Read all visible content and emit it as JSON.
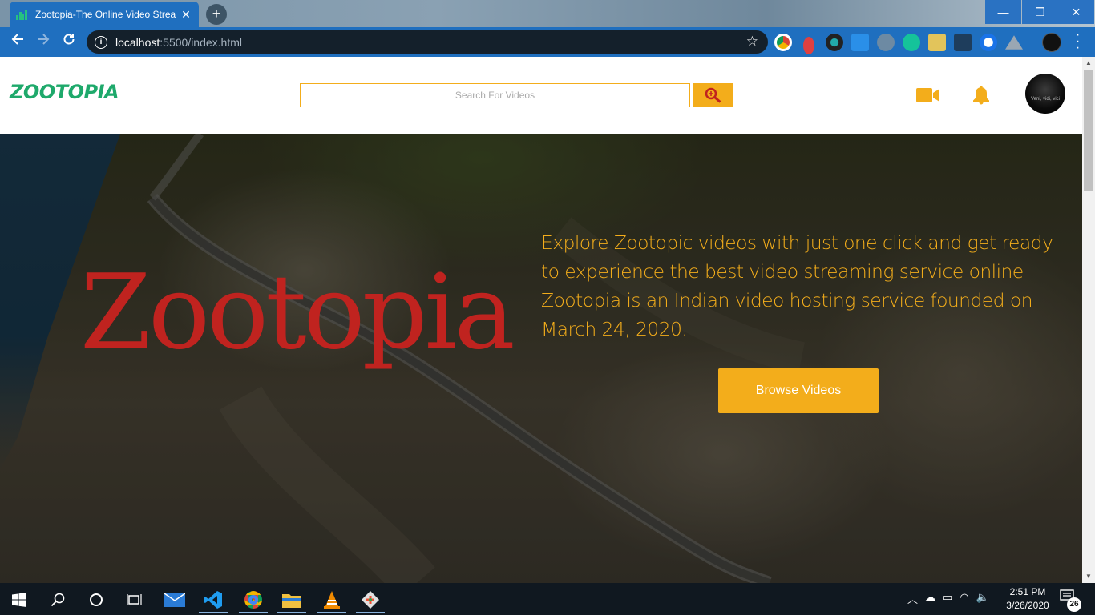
{
  "browser": {
    "tab_title": "Zootopia-The Online Video Strea",
    "tab_close": "✕",
    "new_tab": "+",
    "url_host": "localhost",
    "url_rest": ":5500/index.html",
    "window_controls": {
      "minimize": "—",
      "maximize": "❐",
      "close": "✕"
    },
    "extensions": [
      "chrome-icon",
      "extension-red-icon",
      "extension-dark-icon",
      "extension-blue-icon",
      "extension-bolt-icon",
      "grammarly-icon",
      "extension-photo-icon",
      "extension-chart-icon",
      "extension-circle-icon",
      "drive-icon"
    ]
  },
  "site": {
    "logo_text": "ZOOTOPIA",
    "search_placeholder": "Search For Videos",
    "avatar_caption": "Veni, vidi, vici",
    "hero": {
      "title": "Zootopia",
      "line1": "Explore Zootopic videos with just one click and get ready to experience the best video streaming service online",
      "line2": "Zootopia is an Indian video hosting service founded on March 24, 2020.",
      "button": "Browse Videos"
    },
    "colors": {
      "accent": "#f3ad1b",
      "title_red": "#c0231f",
      "logo_green": "#1ea96b"
    }
  },
  "taskbar": {
    "time": "2:51 PM",
    "date": "3/26/2020",
    "notification_count": "26",
    "apps": [
      "start-icon",
      "search-icon",
      "cortana-icon",
      "task-view-icon",
      "mail-icon",
      "vscode-icon",
      "chrome-icon",
      "file-explorer-icon",
      "vlc-icon",
      "git-icon"
    ]
  }
}
